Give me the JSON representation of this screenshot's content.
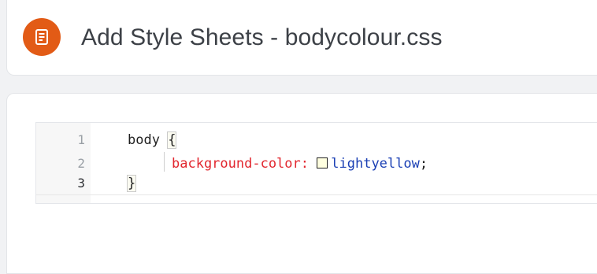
{
  "header": {
    "icon": "stylesheet-document-icon",
    "icon_color": "#e25b16",
    "title": "Add Style Sheets - bodycolour.css"
  },
  "editor": {
    "language": "css",
    "active_line": 3,
    "lines": [
      {
        "number": "1",
        "selector": "body",
        "open_brace": "{"
      },
      {
        "number": "2",
        "property": "background-color",
        "colon": ":",
        "value": "lightyellow",
        "semicolon": ";",
        "swatch_color": "#ffffe0"
      },
      {
        "number": "3",
        "close_brace": "}"
      }
    ],
    "colors": {
      "property": "#e2262e",
      "value": "#1a3fb4",
      "text": "#1f1f1f"
    }
  }
}
